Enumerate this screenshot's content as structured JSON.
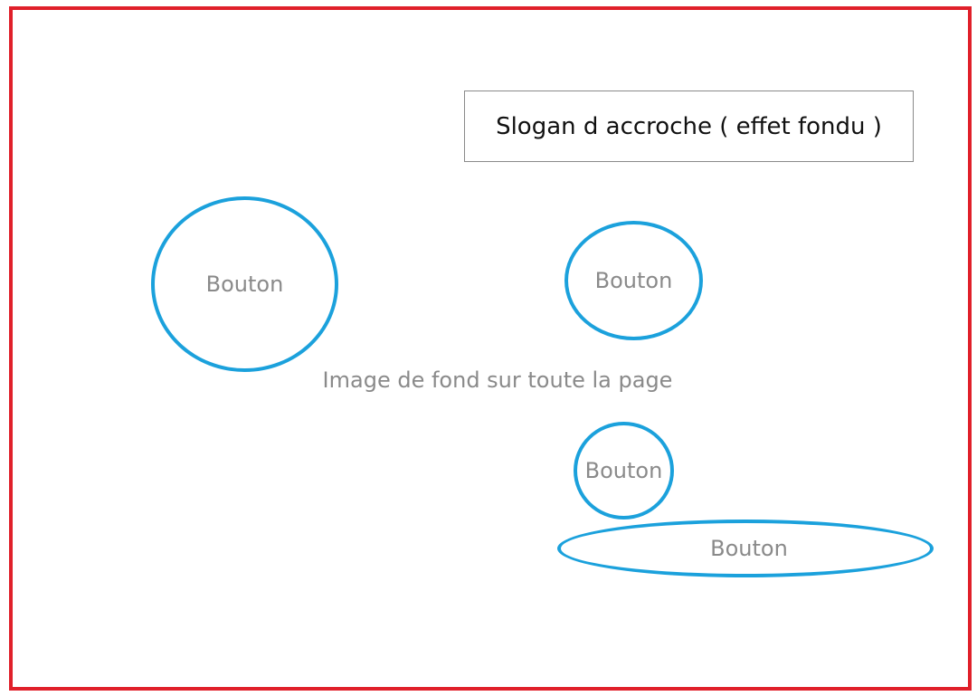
{
  "slogan": {
    "text": "Slogan d accroche ( effet fondu )"
  },
  "background": {
    "label": "Image de fond sur toute la page"
  },
  "buttons": [
    {
      "label": "Bouton"
    },
    {
      "label": "Bouton"
    },
    {
      "label": "Bouton"
    },
    {
      "label": "Bouton"
    }
  ],
  "colors": {
    "frame": "#e0202a",
    "button_border": "#1ba1dc",
    "muted_text": "#8a8a8a",
    "slogan_border": "#8a8a8a"
  }
}
